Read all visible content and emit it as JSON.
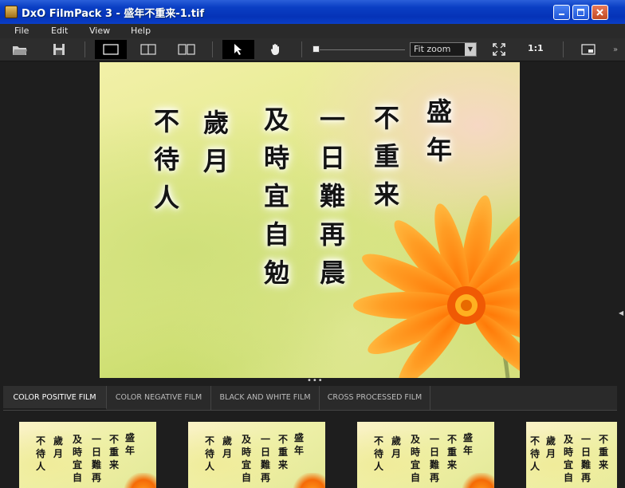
{
  "window": {
    "title": "DxO FilmPack 3 - 盛年不重来-1.tif"
  },
  "menu": [
    "File",
    "Edit",
    "View",
    "Help"
  ],
  "toolbar": {
    "zoom_value": "Fit zoom",
    "one_to_one": "1:1",
    "overflow": "»",
    "icons": [
      "open-folder-icon",
      "save-icon",
      "single-view-icon",
      "split-view-icon",
      "side-by-side-view-icon",
      "pointer-icon",
      "hand-icon",
      "zoom-slider",
      "fit-screen-icon",
      "navigator-icon"
    ]
  },
  "image": {
    "poem_columns": [
      "盛年",
      "不重来",
      "一日難再晨",
      "及時宜自勉",
      "歲月",
      "不待人"
    ]
  },
  "tabs": [
    "COLOR POSITIVE FILM",
    "COLOR NEGATIVE FILM",
    "BLACK AND WHITE FILM",
    "CROSS PROCESSED FILM"
  ],
  "active_tab": 0,
  "thumbnails": [
    {
      "columns": [
        "盛年",
        "不重来",
        "一日難再",
        "及時宜自",
        "歲月",
        "不待人"
      ]
    },
    {
      "columns": [
        "盛年",
        "不重来",
        "一日難再",
        "及時宜自",
        "歲月",
        "不待人"
      ]
    },
    {
      "columns": [
        "盛年",
        "不重来",
        "一日難再",
        "及時宜自",
        "歲月",
        "不待人"
      ]
    },
    {
      "columns": [
        "不重来",
        "一日難再",
        "及時宜自",
        "歲月",
        "不待人"
      ]
    }
  ],
  "colors": {
    "titlebar": "#0a3fc4",
    "flower": "#f56a06",
    "background": "#1e1e1e"
  }
}
